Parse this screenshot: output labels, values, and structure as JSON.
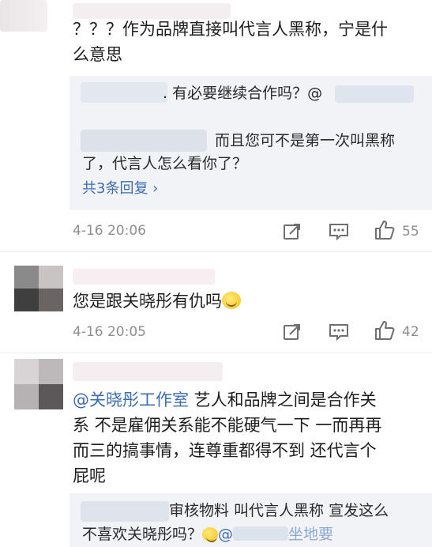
{
  "comment1": {
    "text_line1": "？？？作为品牌直接叫代言人黑称，宁是什",
    "text_line2": "么意思",
    "reply_line1_suffix": ". 有必要继续合作吗？@",
    "reply_line2_suffix": "而且您可不是第一次叫黑称",
    "reply_line3": "了，代言人怎么看你了？",
    "view_replies": "共3条回复 ›",
    "time": "4-16 20:06",
    "likes": "55"
  },
  "comment2": {
    "text": "您是跟关晓彤有仇吗",
    "time": "4-16 20:05",
    "likes": "42"
  },
  "comment3": {
    "mention": "@关晓彤工作室",
    "text_line1": " 艺人和品牌之间是合作关",
    "text_line2": "系 不是雇佣关系能不能硬气一下 一而再再",
    "text_line3": "而三的搞事情，连尊重都得不到 还代言个",
    "text_line4": "屁呢",
    "reply_line1": "审核物料 叫代言人黑称 宣发这么",
    "reply_line2_prefix": "不喜欢关晓彤吗？",
    "reply_line2_suffix": "@",
    "reply_line2_tail": "坐地要"
  },
  "icons": {
    "repost": "repost-icon",
    "comment": "comment-icon",
    "like": "thumbs-up-icon"
  }
}
